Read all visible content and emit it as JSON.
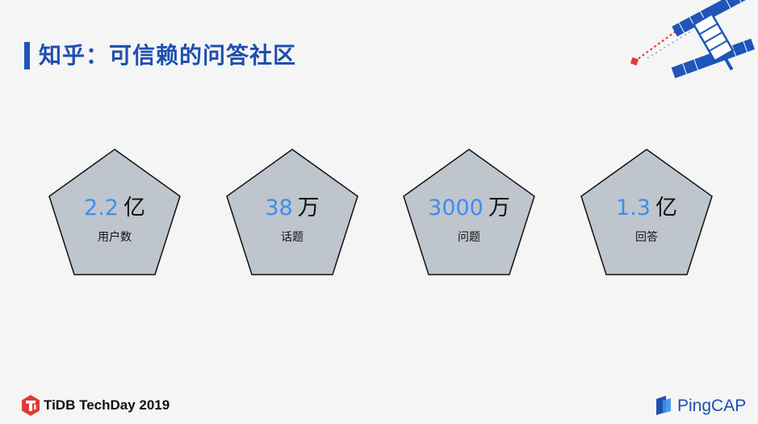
{
  "slide": {
    "title": "知乎：可信赖的问答社区"
  },
  "stats": [
    {
      "value": "2.2",
      "unit": "亿",
      "label": "用户数"
    },
    {
      "value": "38",
      "unit": "万",
      "label": "话题"
    },
    {
      "value": "3000",
      "unit": "万",
      "label": "问题"
    },
    {
      "value": "1.3",
      "unit": "亿",
      "label": "回答"
    }
  ],
  "footer": {
    "event_name": "TiDB TechDay 2019",
    "brand_name": "PingCAP"
  },
  "colors": {
    "title": "#1f4fb0",
    "number": "#3d8ef0",
    "pentagon_fill": "#bfc5cc",
    "accent_red": "#e03a3a"
  },
  "icons": [
    "satellite-icon",
    "tidb-logo-icon",
    "pingcap-logo-icon"
  ]
}
